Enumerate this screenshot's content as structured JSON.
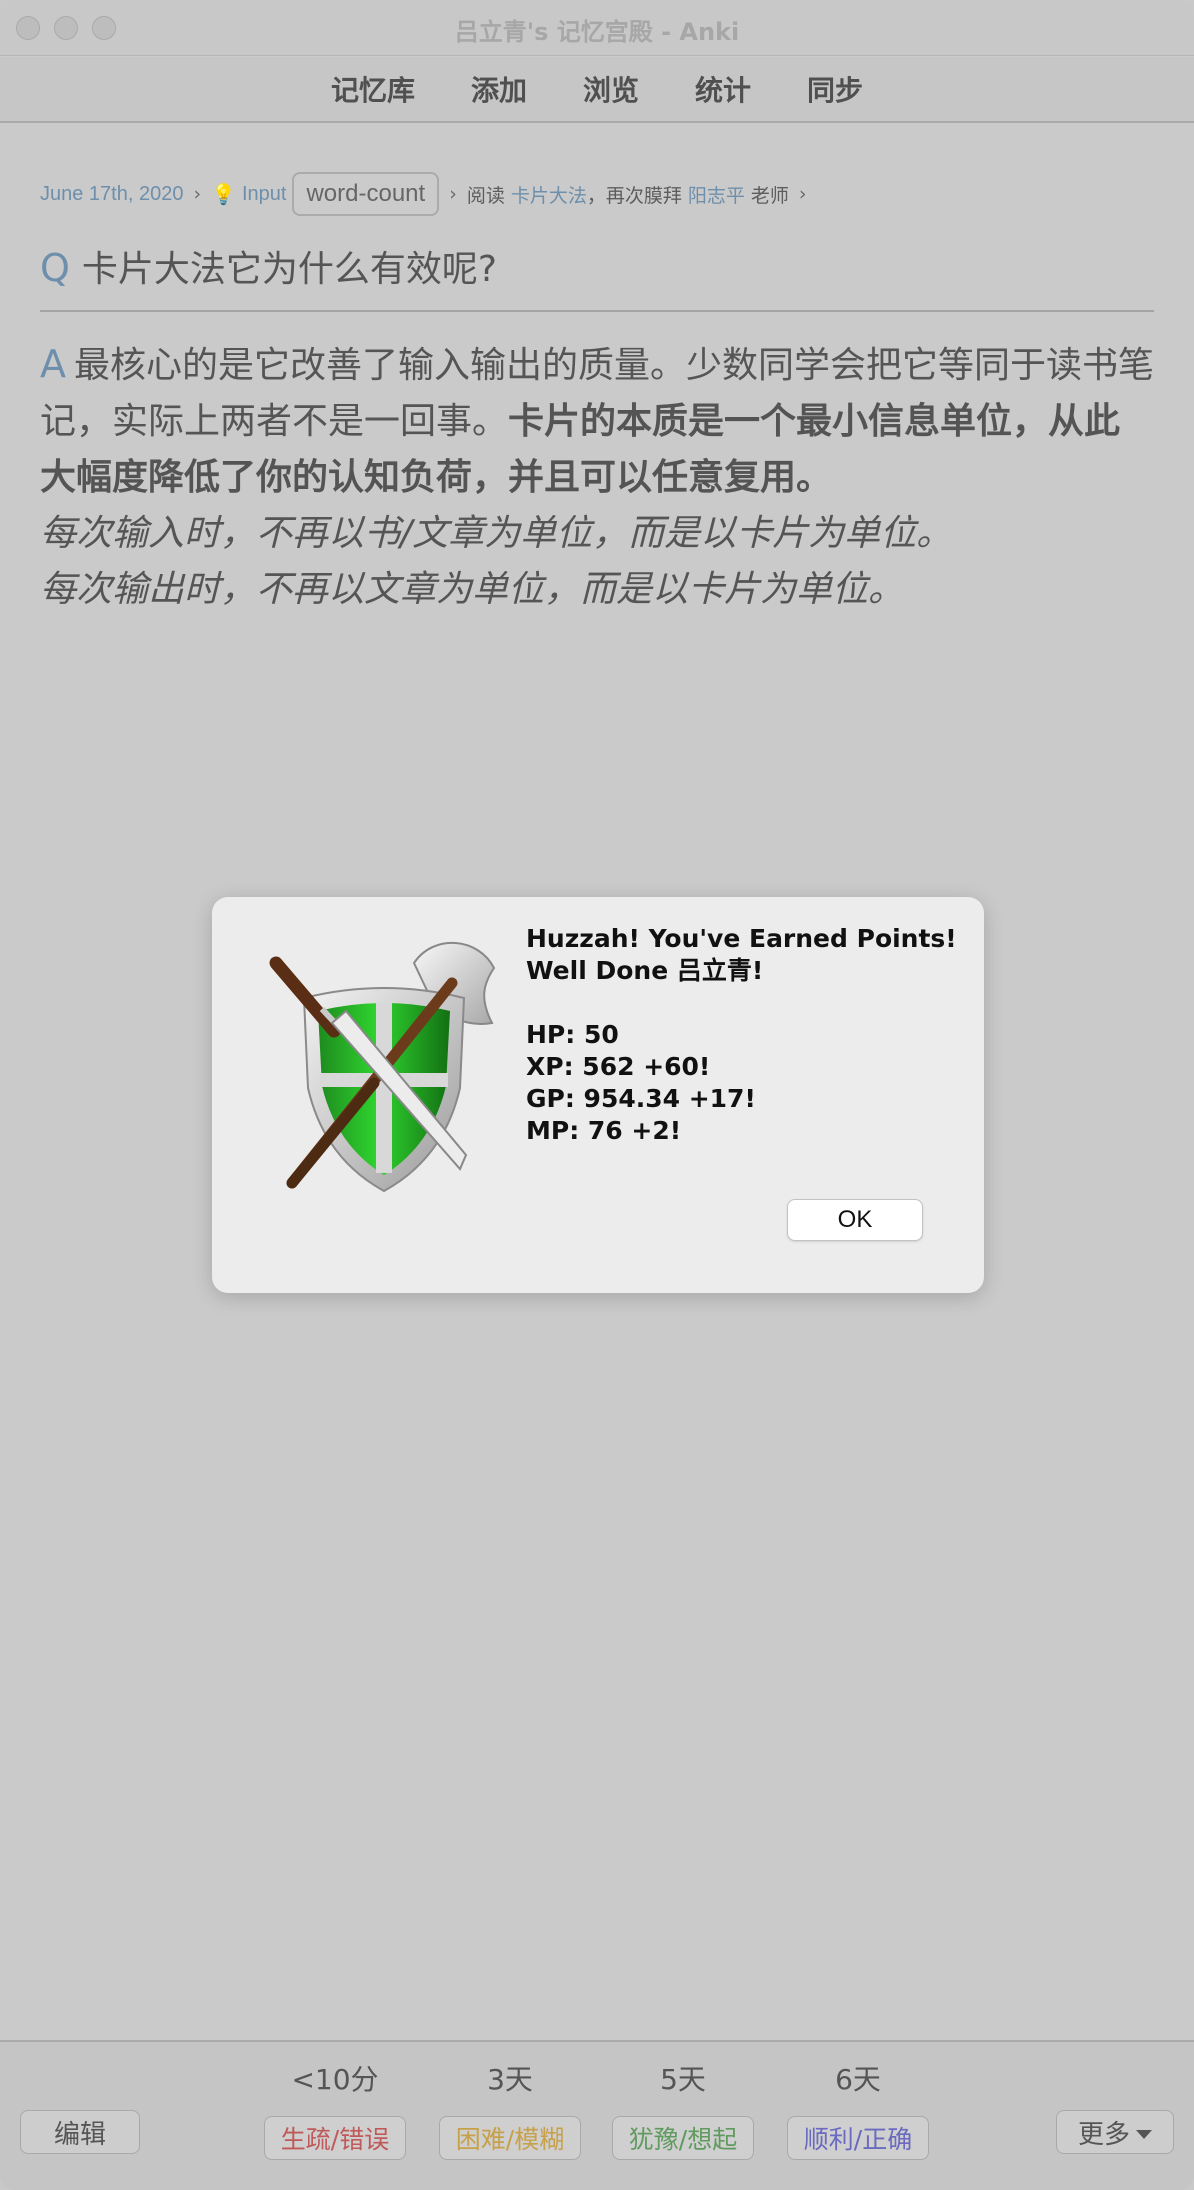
{
  "window": {
    "title": "吕立青's 记忆宫殿 - Anki"
  },
  "toolbar": {
    "items": [
      "记忆库",
      "添加",
      "浏览",
      "统计",
      "同步"
    ]
  },
  "breadcrumb": {
    "date": "June 17th, 2020",
    "separator": "›",
    "input_label": "Input",
    "tag": "word-count",
    "read_text": "阅读",
    "book_link": "卡片大法",
    "middle_text": "，再次膜拜",
    "author_link": "阳志平",
    "suffix_text": "老师"
  },
  "question": {
    "marker": "Q",
    "text": "卡片大法它为什么有效呢?"
  },
  "answer": {
    "marker": "A",
    "plain": "最核心的是它改善了输入输出的质量。少数同学会把它等同于读书笔记，实际上两者不是一回事。",
    "bold": "卡片的本质是一个最小信息单位，从此大幅度降低了你的认知负荷，并且可以任意复用。",
    "italic_1": "每次输入时，不再以书/文章为单位，而是以卡片为单位。",
    "italic_2": "每次输出时，不再以文章为单位，而是以卡片为单位。"
  },
  "dialog": {
    "line1": "Huzzah! You've Earned Points!",
    "line2": "Well Done 吕立青!",
    "hp": "HP: 50",
    "xp": "XP: 562  +60!",
    "gp": "GP: 954.34  +17!",
    "mp": "MP: 76  +2!",
    "ok_label": "OK",
    "icon": "shield-swords-icon"
  },
  "bottom": {
    "edit_label": "编辑",
    "more_label": "更多",
    "ease": [
      {
        "interval": "<10分",
        "label": "生疏/错误",
        "color": "#c05a5a"
      },
      {
        "interval": "3天",
        "label": "困难/模糊",
        "color": "#c7a14a"
      },
      {
        "interval": "5天",
        "label": "犹豫/想起",
        "color": "#5f9a5f"
      },
      {
        "interval": "6天",
        "label": "顺利/正确",
        "color": "#6a6ac0"
      }
    ]
  }
}
